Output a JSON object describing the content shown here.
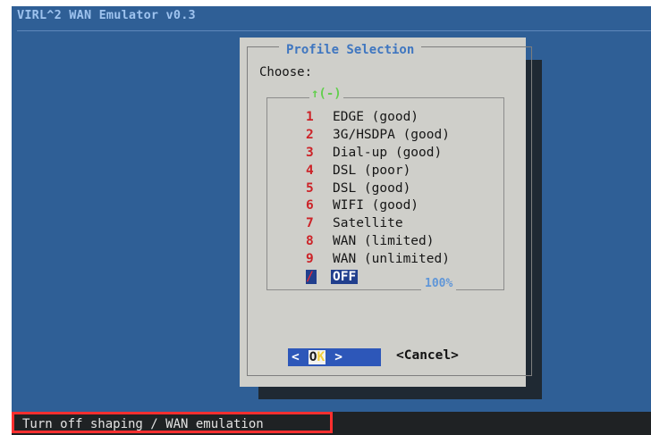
{
  "app": {
    "title": "VIRL^2 WAN Emulator v0.3"
  },
  "dialog": {
    "title": "Profile Selection",
    "prompt": "Choose:",
    "scroll_up": "↑(-)",
    "scroll_percent": "100%",
    "items": [
      {
        "num": "1",
        "label": "EDGE (good)"
      },
      {
        "num": "2",
        "label": "3G/HSDPA (good)"
      },
      {
        "num": "3",
        "label": "Dial-up (good)"
      },
      {
        "num": "4",
        "label": "DSL (poor)"
      },
      {
        "num": "5",
        "label": "DSL (good)"
      },
      {
        "num": "6",
        "label": "WIFI (good)"
      },
      {
        "num": "7",
        "label": "Satellite"
      },
      {
        "num": "8",
        "label": "WAN (limited)"
      },
      {
        "num": "9",
        "label": "WAN (unlimited)"
      },
      {
        "num": "/",
        "label": "OFF"
      }
    ],
    "selected_index": 9,
    "ok_left": "<",
    "ok_o": "O",
    "ok_k": "K",
    "ok_right": ">",
    "cancel_label": "<Cancel>"
  },
  "status": {
    "text": "Turn off shaping / WAN emulation"
  },
  "colors": {
    "background": "#2f5f96",
    "dialog": "#cfcfca",
    "accent": "#2d57b9",
    "number": "#cc2328",
    "highlight": "#ff2f2f"
  }
}
